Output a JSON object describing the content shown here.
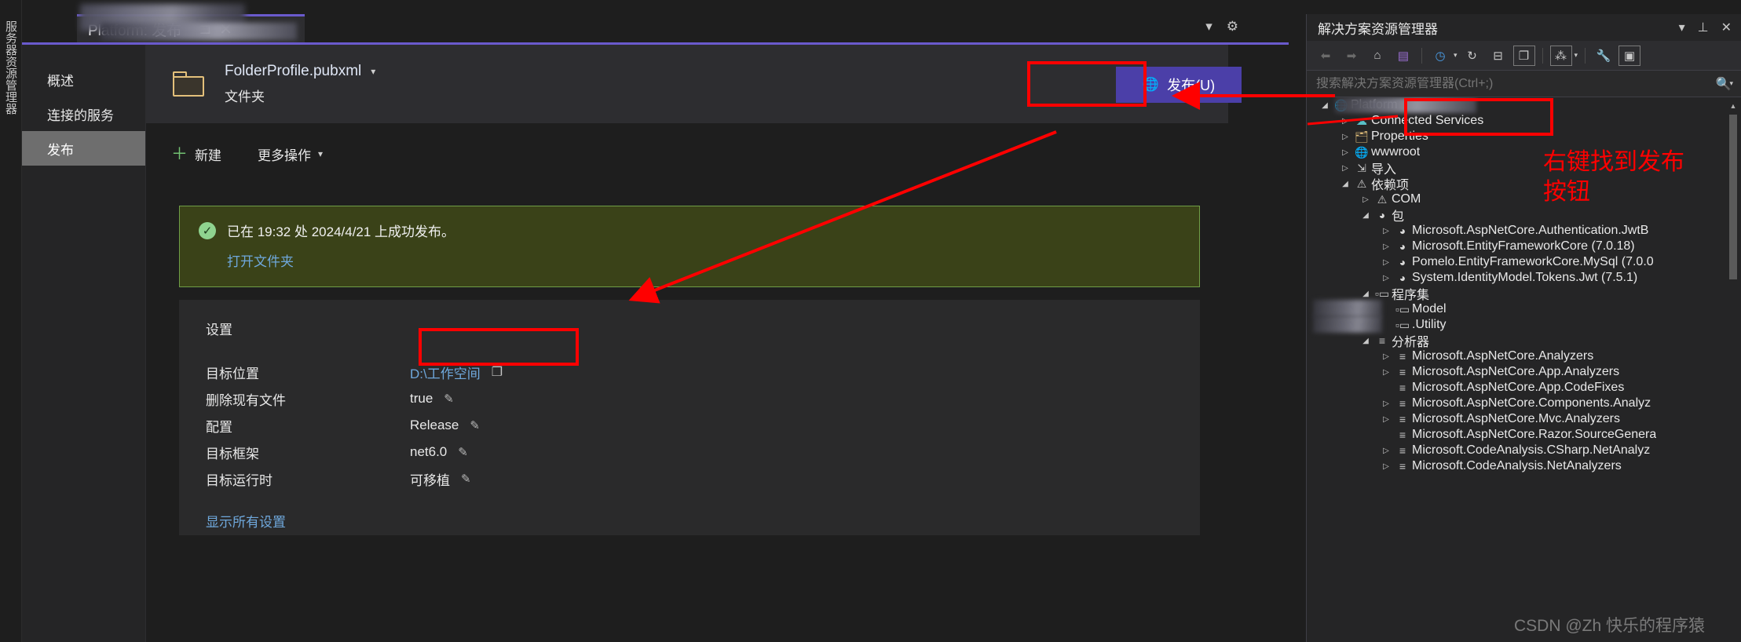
{
  "window": {
    "vertical_dock_label": "服务器资源管理器",
    "tab_title": "Platform: 发布",
    "tab_pin_icon": "pin-icon",
    "tab_close_icon": "close-icon",
    "tabbar_dropdown_icon": "chevron-down-icon",
    "tabbar_settings_icon": "gear-icon"
  },
  "doc_nav": {
    "items": [
      {
        "label": "概述",
        "active": false
      },
      {
        "label": "连接的服务",
        "active": false
      },
      {
        "label": "发布",
        "active": true
      }
    ]
  },
  "profile": {
    "icon": "folder-icon",
    "name": "FolderProfile.pubxml",
    "dropdown_icon": "chevron-down-icon",
    "subtitle": "文件夹"
  },
  "actions": {
    "new_label": "新建",
    "new_icon": "plus-icon",
    "more_label": "更多操作",
    "more_icon": "chevron-down-icon",
    "publish_label": "发布(U)",
    "publish_icon": "publish-globe-icon"
  },
  "banner": {
    "status_icon": "check-circle-icon",
    "message": "已在 19:32 处 2024/4/21 上成功发布。",
    "link": "打开文件夹"
  },
  "settings": {
    "title": "设置",
    "rows": [
      {
        "key": "目标位置",
        "value": "D:\\工作空间",
        "is_link": true,
        "action_icon": "copy-icon"
      },
      {
        "key": "删除现有文件",
        "value": "true",
        "is_link": false,
        "action_icon": "pencil-icon"
      },
      {
        "key": "配置",
        "value": "Release",
        "is_link": false,
        "action_icon": "pencil-icon"
      },
      {
        "key": "目标框架",
        "value": "net6.0",
        "is_link": false,
        "action_icon": "pencil-icon"
      },
      {
        "key": "目标运行时",
        "value": "可移植",
        "is_link": false,
        "action_icon": "pencil-icon"
      }
    ],
    "show_all_label": "显示所有设置"
  },
  "solution_explorer": {
    "title": "解决方案资源管理器",
    "header_icons": [
      "chevron-down-icon",
      "pin-icon",
      "close-icon"
    ],
    "toolbar_icons": [
      "back-arrow-icon",
      "forward-arrow-icon",
      "home-icon",
      "vs-solution-icon",
      "pending-changes-icon",
      "refresh-icon",
      "collapse-all-icon",
      "show-all-files-icon",
      "view-code-map-icon",
      "properties-wrench-icon",
      "preview-selected-items-icon"
    ],
    "search_placeholder": "搜索解决方案资源管理器(Ctrl+;)",
    "search_icon": "search-icon",
    "tree": [
      {
        "depth": 0,
        "twisty": "open",
        "icon": "globe-icon",
        "icon_class": "blue",
        "label": "Platform",
        "redacted": true
      },
      {
        "depth": 1,
        "twisty": "closed",
        "icon": "connected-services-icon",
        "icon_class": "cyan",
        "label": "Connected Services"
      },
      {
        "depth": 1,
        "twisty": "closed",
        "icon": "properties-icon",
        "icon_class": "gold",
        "label": "Properties"
      },
      {
        "depth": 1,
        "twisty": "closed",
        "icon": "wwwroot-globe-icon",
        "icon_class": "blue",
        "label": "wwwroot"
      },
      {
        "depth": 1,
        "twisty": "closed",
        "icon": "import-icon",
        "icon_class": "grey",
        "label": "导入"
      },
      {
        "depth": 1,
        "twisty": "open",
        "icon": "dependencies-warning-icon",
        "icon_class": "grey",
        "label": "依赖项"
      },
      {
        "depth": 2,
        "twisty": "closed",
        "icon": "com-warning-icon",
        "icon_class": "grey",
        "label": "COM"
      },
      {
        "depth": 2,
        "twisty": "open",
        "icon": "package-icon",
        "icon_class": "pkg-dot",
        "label": "包"
      },
      {
        "depth": 3,
        "twisty": "closed",
        "icon": "package-icon",
        "icon_class": "pkg-dot",
        "label": "Microsoft.AspNetCore.Authentication.JwtB"
      },
      {
        "depth": 3,
        "twisty": "closed",
        "icon": "package-icon",
        "icon_class": "pkg-dot",
        "label": "Microsoft.EntityFrameworkCore (7.0.18)"
      },
      {
        "depth": 3,
        "twisty": "closed",
        "icon": "package-icon",
        "icon_class": "pkg-dot",
        "label": "Pomelo.EntityFrameworkCore.MySql (7.0.0"
      },
      {
        "depth": 3,
        "twisty": "closed",
        "icon": "package-icon",
        "icon_class": "pkg-dot",
        "label": "System.IdentityModel.Tokens.Jwt (7.5.1)"
      },
      {
        "depth": 2,
        "twisty": "open",
        "icon": "assembly-icon",
        "icon_class": "grey",
        "label": "程序集"
      },
      {
        "depth": 3,
        "twisty": "none",
        "icon": "assembly-icon",
        "icon_class": "grey",
        "label": "Model",
        "redacted": true
      },
      {
        "depth": 3,
        "twisty": "none",
        "icon": "assembly-icon",
        "icon_class": "grey",
        "label": ".Utility",
        "redacted": true
      },
      {
        "depth": 2,
        "twisty": "open",
        "icon": "analyzers-info-icon",
        "icon_class": "grey",
        "label": "分析器"
      },
      {
        "depth": 3,
        "twisty": "closed",
        "icon": "analyzer-lock-icon",
        "icon_class": "grey",
        "label": "Microsoft.AspNetCore.Analyzers"
      },
      {
        "depth": 3,
        "twisty": "closed",
        "icon": "analyzer-icon",
        "icon_class": "grey",
        "label": "Microsoft.AspNetCore.App.Analyzers"
      },
      {
        "depth": 3,
        "twisty": "none",
        "icon": "analyzer-icon",
        "icon_class": "grey",
        "label": "Microsoft.AspNetCore.App.CodeFixes"
      },
      {
        "depth": 3,
        "twisty": "closed",
        "icon": "analyzer-lock-icon",
        "icon_class": "grey",
        "label": "Microsoft.AspNetCore.Components.Analyz"
      },
      {
        "depth": 3,
        "twisty": "closed",
        "icon": "analyzer-lock-icon",
        "icon_class": "grey",
        "label": "Microsoft.AspNetCore.Mvc.Analyzers"
      },
      {
        "depth": 3,
        "twisty": "none",
        "icon": "analyzer-icon",
        "icon_class": "grey",
        "label": "Microsoft.AspNetCore.Razor.SourceGenera"
      },
      {
        "depth": 3,
        "twisty": "closed",
        "icon": "analyzer-lock-icon",
        "icon_class": "grey",
        "label": "Microsoft.CodeAnalysis.CSharp.NetAnalyz"
      },
      {
        "depth": 3,
        "twisty": "closed",
        "icon": "analyzer-lock-icon",
        "icon_class": "grey",
        "label": "Microsoft.CodeAnalysis.NetAnalyzers"
      }
    ]
  },
  "annotations": {
    "hint_line1": "右键找到发布",
    "hint_line2": "按钮",
    "color": "#ff0000"
  },
  "watermark": "CSDN @Zh 快乐的程序猿"
}
